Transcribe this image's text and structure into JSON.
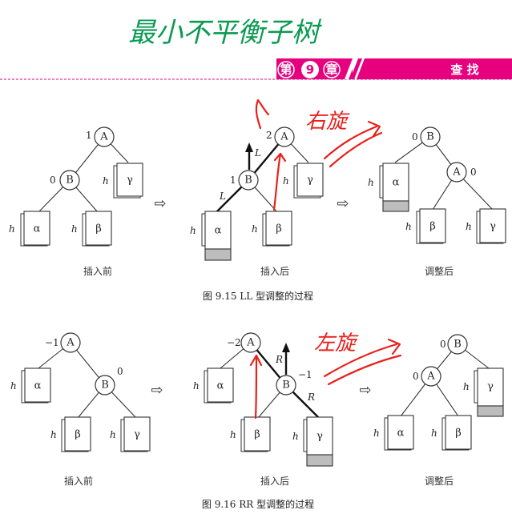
{
  "handwritten_title": "最小不平衡子树",
  "header": {
    "chapter_prefix": "第",
    "chapter_number": "9",
    "chapter_suffix": "章",
    "section_title": "查 找",
    "accent_color": "#e6007e"
  },
  "annotations": {
    "right_rotation": "右旋",
    "left_rotation": "左旋",
    "annotation_color": "#e8211c"
  },
  "figure_ll": {
    "caption": "图 9.15   LL 型调整的过程",
    "before": {
      "label": "插入前",
      "nodes": {
        "A": "A",
        "B": "B"
      },
      "balance": {
        "A": "1",
        "B": "0"
      },
      "subtrees": {
        "alpha": "α",
        "beta": "β",
        "gamma": "γ"
      },
      "height": "h"
    },
    "after_insert": {
      "label": "插入后",
      "nodes": {
        "A": "A",
        "B": "B"
      },
      "balance": {
        "A": "2",
        "B": "1"
      },
      "edge_labels": {
        "upper": "L",
        "lower": "L"
      },
      "subtrees": {
        "alpha": "α",
        "beta": "β",
        "gamma": "γ"
      },
      "height": "h"
    },
    "adjusted": {
      "label": "调整后",
      "nodes": {
        "A": "A",
        "B": "B"
      },
      "balance": {
        "A": "0",
        "B": "0"
      },
      "subtrees": {
        "alpha": "α",
        "beta": "β",
        "gamma": "γ"
      },
      "height": "h"
    },
    "transition_arrow": "⇨"
  },
  "figure_rr": {
    "caption": "图 9.16   RR 型调整的过程",
    "before": {
      "label": "插入前",
      "nodes": {
        "A": "A",
        "B": "B"
      },
      "balance": {
        "A": "−1",
        "B": "0"
      },
      "subtrees": {
        "alpha": "α",
        "beta": "β",
        "gamma": "γ"
      },
      "height": "h"
    },
    "after_insert": {
      "label": "插入后",
      "nodes": {
        "A": "A",
        "B": "B"
      },
      "balance": {
        "A": "−2",
        "B": "−1"
      },
      "edge_labels": {
        "upper": "R",
        "lower": "R"
      },
      "subtrees": {
        "alpha": "α",
        "beta": "β",
        "gamma": "γ"
      },
      "height": "h"
    },
    "adjusted": {
      "label": "调整后",
      "nodes": {
        "A": "A",
        "B": "B"
      },
      "balance": {
        "A": "0",
        "B": "0"
      },
      "subtrees": {
        "alpha": "α",
        "beta": "β",
        "gamma": "γ"
      },
      "height": "h"
    },
    "transition_arrow": "⇨"
  }
}
